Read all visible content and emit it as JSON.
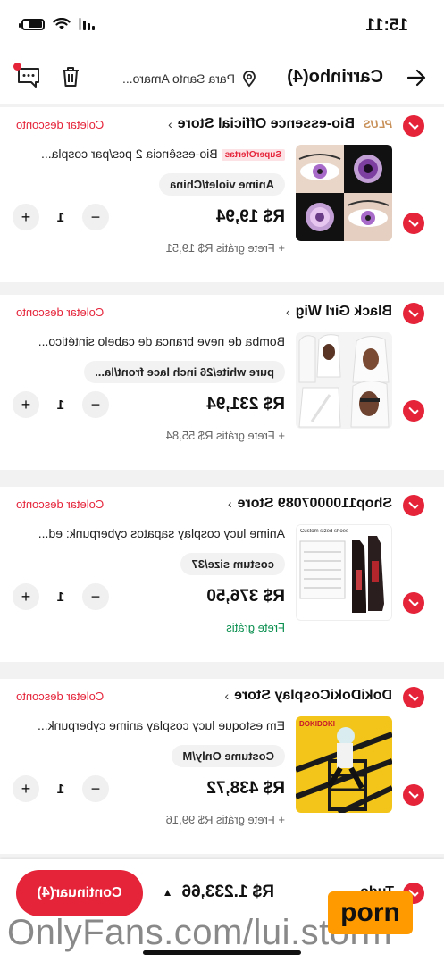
{
  "status_bar": {
    "time": "15:11"
  },
  "header": {
    "title": "Carrinho(4)",
    "location": "Para Santo Amaro..."
  },
  "stores": [
    {
      "plus": "PLUS",
      "name": "Bio-essence Official Store",
      "coupon": "Coletar desconto",
      "item": {
        "badge": "SuperOfertas",
        "description": "Bio-essência 2 pcs/par cospla...",
        "variant": "Anime violet/China",
        "price": "R$ 19,94",
        "qty": "1",
        "shipping": "+ Frete grátis R$ 19,51"
      }
    },
    {
      "name": "Black Girl Wig",
      "coupon": "Coletar desconto",
      "item": {
        "description": "Bomba de neve branca de cabelo sintético...",
        "variant": "pure white/26 inch lace front/la...",
        "price": "R$ 231,94",
        "qty": "1",
        "shipping": "+ Frete grátis R$ 55,84"
      }
    },
    {
      "name": "Shop1100007089 Store",
      "coupon": "Coletar desconto",
      "item": {
        "description": "Anime lucy cosplay sapatos cyberpunk: ed...",
        "variant": "costum size/37",
        "price": "R$ 376,50",
        "qty": "1",
        "shipping": "Frete grátis",
        "thumb_caption": "Custom sized shoes"
      }
    },
    {
      "name": "DokiDokiCosplay Store",
      "coupon": "Coletar desconto",
      "item": {
        "description": "Em estoque lucy cosplay anime cyberpunk...",
        "variant": "Costume Only/M",
        "price": "R$ 438,72",
        "qty": "1",
        "shipping": "+ Frete grátis R$ 99,16",
        "thumb_caption": "DOKIDOKI"
      }
    }
  ],
  "bottom": {
    "all_label": "Tudo",
    "total": "R$ 1.233,66",
    "cta": "Continuar(4)"
  },
  "watermark": {
    "text": "OnlyFans.com/lui.storm",
    "logo": "porn"
  },
  "colors": {
    "accent": "#e5243a",
    "free_shipping": "#0a8f4f",
    "plus": "#c9915a"
  }
}
